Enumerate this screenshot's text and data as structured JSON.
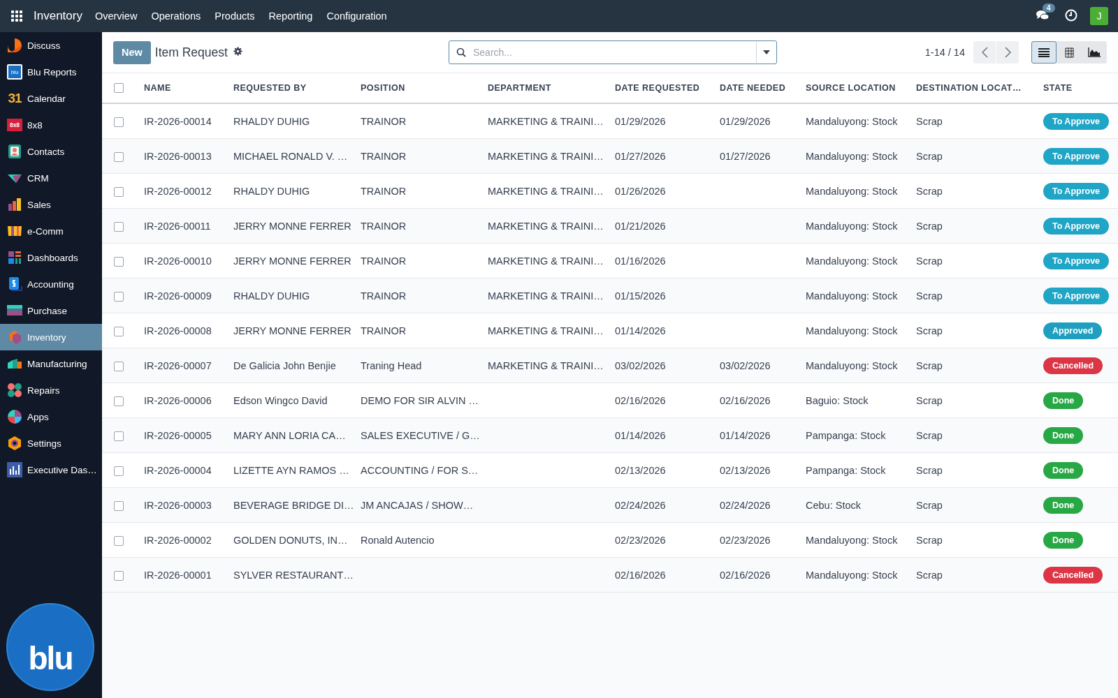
{
  "topbar": {
    "app_name": "Inventory",
    "menu": [
      "Overview",
      "Operations",
      "Products",
      "Reporting",
      "Configuration"
    ],
    "messages_badge": "4",
    "avatar_letter": "J"
  },
  "sidebar": {
    "items": [
      {
        "label": "Discuss",
        "kind": "discuss",
        "selected": false
      },
      {
        "label": "Blu Reports",
        "kind": "blu",
        "icon_text": "blu",
        "selected": false
      },
      {
        "label": "Calendar",
        "kind": "calendar",
        "icon_text": "31",
        "selected": false
      },
      {
        "label": "8x8",
        "kind": "eightbyeight",
        "icon_text": "8x8",
        "selected": false
      },
      {
        "label": "Contacts",
        "kind": "contacts",
        "selected": false
      },
      {
        "label": "CRM",
        "kind": "crm",
        "selected": false
      },
      {
        "label": "Sales",
        "kind": "sales",
        "selected": false
      },
      {
        "label": "e-Comm",
        "kind": "ecomm",
        "selected": false
      },
      {
        "label": "Dashboards",
        "kind": "dashboards",
        "selected": false
      },
      {
        "label": "Accounting",
        "kind": "accounting",
        "selected": false
      },
      {
        "label": "Purchase",
        "kind": "purchase",
        "selected": false
      },
      {
        "label": "Inventory",
        "kind": "inventory",
        "selected": true
      },
      {
        "label": "Manufacturing",
        "kind": "manufacturing",
        "selected": false
      },
      {
        "label": "Repairs",
        "kind": "repairs",
        "selected": false
      },
      {
        "label": "Apps",
        "kind": "apps",
        "selected": false
      },
      {
        "label": "Settings",
        "kind": "settings",
        "selected": false
      },
      {
        "label": "Executive Das…",
        "kind": "executive",
        "selected": false
      }
    ],
    "logo_text": "blu"
  },
  "control_panel": {
    "new_button": "New",
    "title": "Item Request",
    "search": {
      "placeholder": "Search..."
    },
    "pager": "1-14 / 14",
    "views": [
      {
        "kind": "list",
        "selected": true
      },
      {
        "kind": "pivot",
        "selected": false
      },
      {
        "kind": "graph",
        "selected": false
      }
    ]
  },
  "table": {
    "select_all": {
      "checked": false
    },
    "columns": [
      "NAME",
      "REQUESTED BY",
      "POSITION",
      "DEPARTMENT",
      "DATE REQUESTED",
      "DATE NEEDED",
      "SOURCE LOCATION",
      "DESTINATION LOCAT…",
      "STATE"
    ],
    "rows": [
      {
        "checked": false,
        "cells": [
          "IR-2026-00014",
          "RHALDY DUHIG",
          "TRAINOR",
          "MARKETING & TRAINI…",
          "01/29/2026",
          "01/29/2026",
          "Mandaluyong: Stock",
          "Scrap"
        ],
        "state": {
          "label": "To Approve",
          "color": "#1fa5c6"
        }
      },
      {
        "checked": false,
        "cells": [
          "IR-2026-00013",
          "MICHAEL RONALD V. …",
          "TRAINOR",
          "MARKETING & TRAINI…",
          "01/27/2026",
          "01/27/2026",
          "Mandaluyong: Stock",
          "Scrap"
        ],
        "state": {
          "label": "To Approve",
          "color": "#1fa5c6"
        }
      },
      {
        "checked": false,
        "cells": [
          "IR-2026-00012",
          "RHALDY DUHIG",
          "TRAINOR",
          "MARKETING & TRAINI…",
          "01/26/2026",
          "",
          "Mandaluyong: Stock",
          "Scrap"
        ],
        "state": {
          "label": "To Approve",
          "color": "#1fa5c6"
        }
      },
      {
        "checked": false,
        "cells": [
          "IR-2026-00011",
          "JERRY MONNE FERRER",
          "TRAINOR",
          "MARKETING & TRAINI…",
          "01/21/2026",
          "",
          "Mandaluyong: Stock",
          "Scrap"
        ],
        "state": {
          "label": "To Approve",
          "color": "#1fa5c6"
        }
      },
      {
        "checked": false,
        "cells": [
          "IR-2026-00010",
          "JERRY MONNE FERRER",
          "TRAINOR",
          "MARKETING & TRAINI…",
          "01/16/2026",
          "",
          "Mandaluyong: Stock",
          "Scrap"
        ],
        "state": {
          "label": "To Approve",
          "color": "#1fa5c6"
        }
      },
      {
        "checked": false,
        "cells": [
          "IR-2026-00009",
          "RHALDY DUHIG",
          "TRAINOR",
          "MARKETING & TRAINI…",
          "01/15/2026",
          "",
          "Mandaluyong: Stock",
          "Scrap"
        ],
        "state": {
          "label": "To Approve",
          "color": "#1fa5c6"
        }
      },
      {
        "checked": false,
        "cells": [
          "IR-2026-00008",
          "JERRY MONNE FERRER",
          "TRAINOR",
          "MARKETING & TRAINI…",
          "01/14/2026",
          "",
          "Mandaluyong: Stock",
          "Scrap"
        ],
        "state": {
          "label": "Approved",
          "color": "#1f9fbf"
        }
      },
      {
        "checked": false,
        "cells": [
          "IR-2026-00007",
          "De Galicia John Benjie",
          "Traning Head",
          "MARKETING & TRAINI…",
          "03/02/2026",
          "03/02/2026",
          "Mandaluyong: Stock",
          "Scrap"
        ],
        "state": {
          "label": "Cancelled",
          "color": "#dc3545"
        }
      },
      {
        "checked": false,
        "cells": [
          "IR-2026-00006",
          "Edson Wingco David",
          "DEMO FOR SIR ALVIN …",
          "",
          "02/16/2026",
          "02/16/2026",
          "Baguio: Stock",
          "Scrap"
        ],
        "state": {
          "label": "Done",
          "color": "#28a745"
        }
      },
      {
        "checked": false,
        "cells": [
          "IR-2026-00005",
          "MARY ANN LORIA CA…",
          "SALES EXECUTIVE / G…",
          "",
          "01/14/2026",
          "01/14/2026",
          "Pampanga: Stock",
          "Scrap"
        ],
        "state": {
          "label": "Done",
          "color": "#28a745"
        }
      },
      {
        "checked": false,
        "cells": [
          "IR-2026-00004",
          "LIZETTE AYN RAMOS …",
          "ACCOUNTING / FOR S…",
          "",
          "02/13/2026",
          "02/13/2026",
          "Pampanga: Stock",
          "Scrap"
        ],
        "state": {
          "label": "Done",
          "color": "#28a745"
        }
      },
      {
        "checked": false,
        "cells": [
          "IR-2026-00003",
          "BEVERAGE BRIDGE DI…",
          "JM ANCAJAS / SHOW…",
          "",
          "02/24/2026",
          "02/24/2026",
          "Cebu: Stock",
          "Scrap"
        ],
        "state": {
          "label": "Done",
          "color": "#28a745"
        }
      },
      {
        "checked": false,
        "cells": [
          "IR-2026-00002",
          "GOLDEN DONUTS, IN…",
          "Ronald Autencio",
          "",
          "02/23/2026",
          "02/23/2026",
          "Mandaluyong: Stock",
          "Scrap"
        ],
        "state": {
          "label": "Done",
          "color": "#28a745"
        }
      },
      {
        "checked": false,
        "cells": [
          "IR-2026-00001",
          "SYLVER RESTAURANT…",
          "",
          "",
          "02/16/2026",
          "02/16/2026",
          "Mandaluyong: Stock",
          "Scrap"
        ],
        "state": {
          "label": "Cancelled",
          "color": "#dc3545"
        }
      }
    ]
  }
}
